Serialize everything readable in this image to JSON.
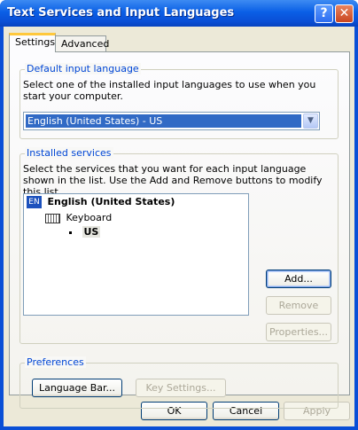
{
  "window": {
    "title": "Text Services and Input Languages",
    "help_label": "?",
    "close_label": "✕"
  },
  "tabs": [
    {
      "label": "Settings"
    },
    {
      "label": "Advanced"
    }
  ],
  "default_input": {
    "legend": "Default input language",
    "description": "Select one of the installed input languages to use when you start your computer.",
    "selected": "English (United States) - US",
    "arrow": "▼"
  },
  "installed": {
    "legend": "Installed services",
    "description": "Select the services that you want for each input language shown in the list. Use the Add and Remove buttons to modify this list.",
    "tree": {
      "language_code": "EN",
      "language": "English (United States)",
      "category": "Keyboard",
      "layout": "US"
    },
    "add_label": "Add...",
    "remove_label": "Remove",
    "properties_label": "Properties..."
  },
  "preferences": {
    "legend": "Preferences",
    "language_bar_label": "Language Bar...",
    "key_settings_label": "Key Settings..."
  },
  "footer": {
    "ok_label": "OK",
    "cancel_label": "Cancel",
    "apply_label": "Apply"
  },
  "colors": {
    "title_bar": "#0a4fd6",
    "legend_text": "#0046d5",
    "selection": "#316ac5"
  }
}
